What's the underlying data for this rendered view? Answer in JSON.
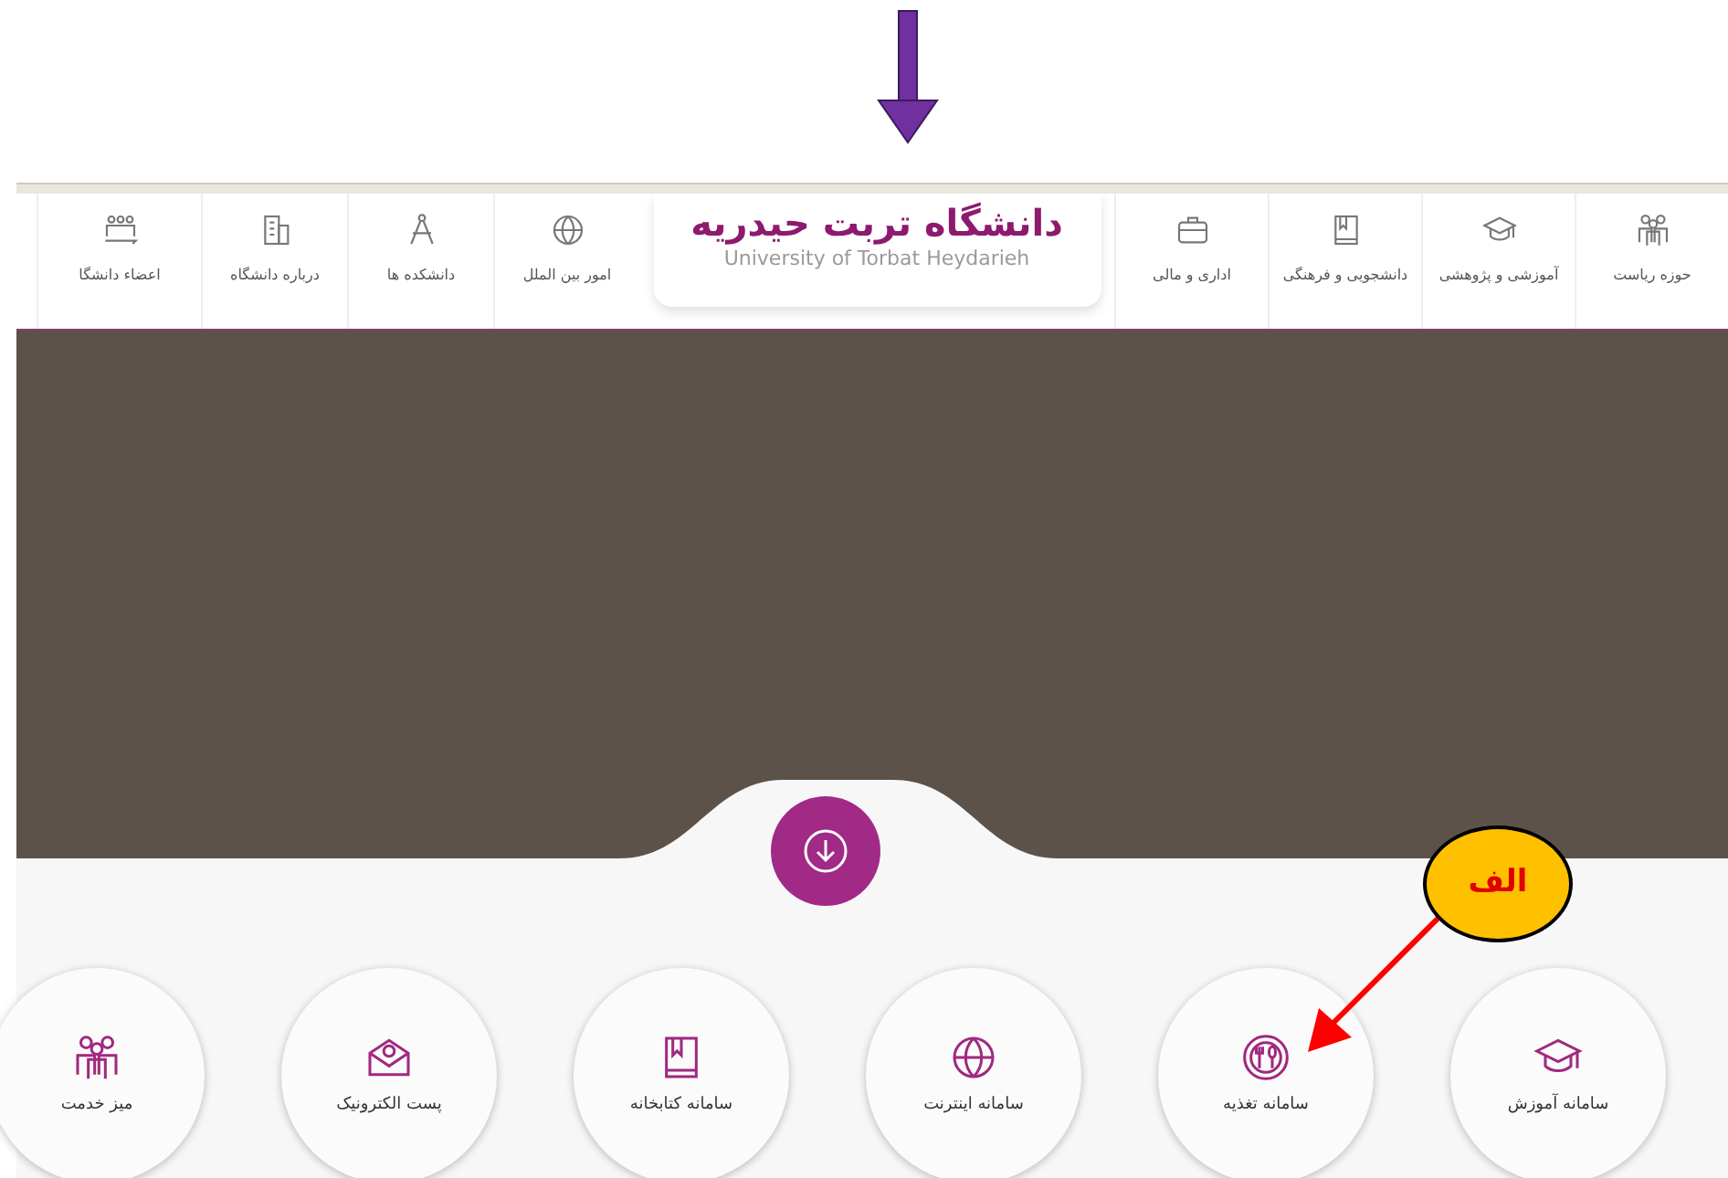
{
  "header": {
    "logo_title": "دانشگاه تربت حیدریه",
    "logo_subtitle": "University of Torbat Heydarieh"
  },
  "nav_right": [
    {
      "label": "حوزه ریاست",
      "kind": "people"
    },
    {
      "label": "آموزشی و پژوهشی",
      "kind": "cap"
    },
    {
      "label": "دانشجویی و فرهنگی",
      "kind": "book"
    },
    {
      "label": "اداری و مالی",
      "kind": "briefcase"
    }
  ],
  "nav_left": [
    {
      "label": "امور بین الملل",
      "kind": "globe"
    },
    {
      "label": "دانشکده ها",
      "kind": "compass"
    },
    {
      "label": "درباره دانشگاه",
      "kind": "building"
    },
    {
      "label": "اعضاء دانشگا",
      "kind": "group"
    }
  ],
  "quick_links": [
    {
      "label": "سامانه آموزش",
      "kind": "cap"
    },
    {
      "label": "سامانه تغذیه",
      "kind": "food"
    },
    {
      "label": "سامانه اینترنت",
      "kind": "globe"
    },
    {
      "label": "سامانه کتابخانه",
      "kind": "book"
    },
    {
      "label": "پست الکترونیک",
      "kind": "mail"
    },
    {
      "label": "میز خدمت",
      "kind": "people"
    }
  ],
  "annotation": {
    "callout": "الف"
  }
}
